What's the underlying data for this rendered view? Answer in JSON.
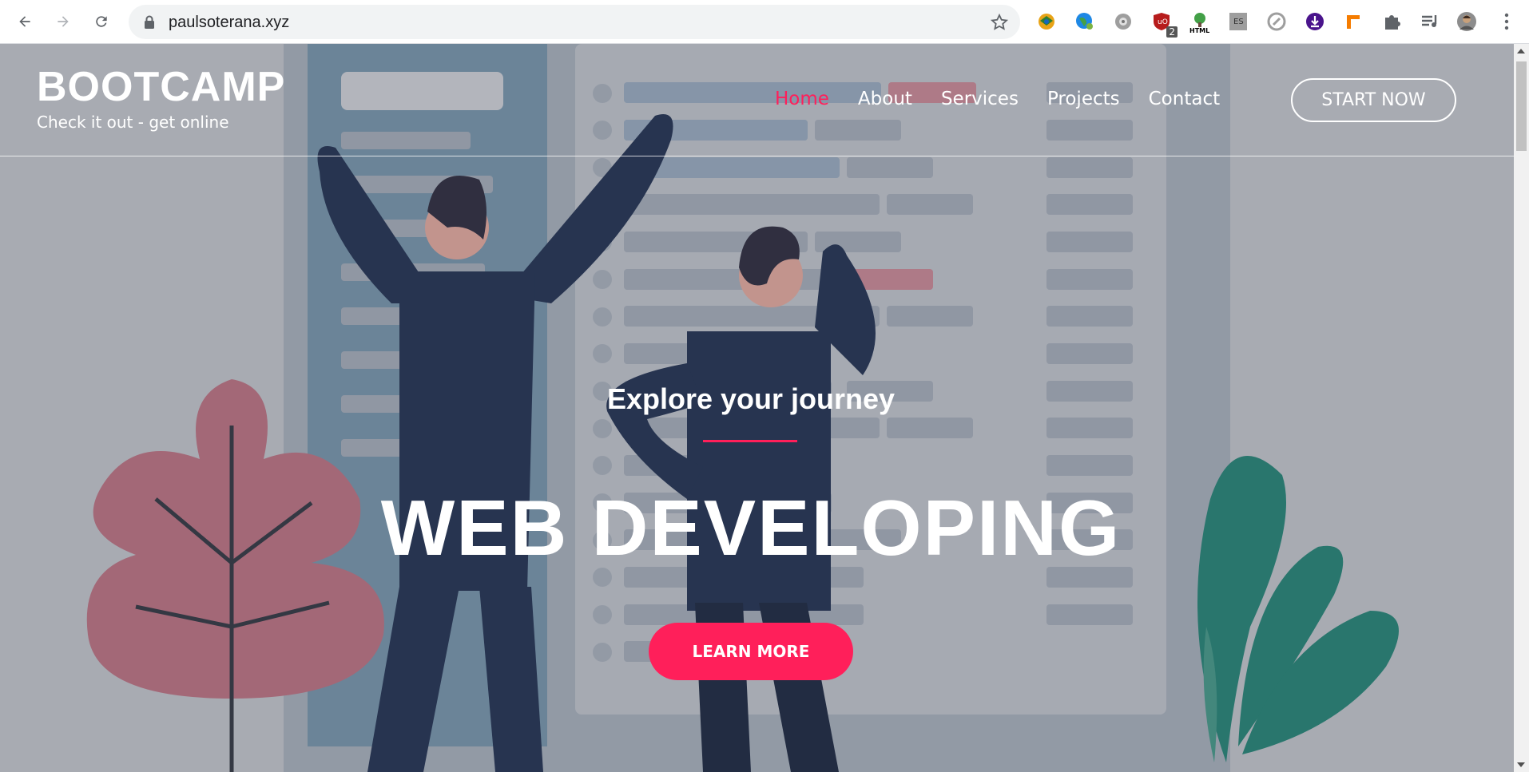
{
  "browser": {
    "url": "paulsoterana.xyz",
    "extensions": [
      {
        "name": "extension-1-icon"
      },
      {
        "name": "globe-extension-icon"
      },
      {
        "name": "gear-extension-icon"
      },
      {
        "name": "ublock-shield-icon",
        "badge": "2"
      },
      {
        "name": "html-tree-icon",
        "label": "HTML"
      },
      {
        "name": "es-extension-icon",
        "label": "ES"
      },
      {
        "name": "link-extension-icon"
      },
      {
        "name": "download-extension-icon"
      },
      {
        "name": "ruler-extension-icon"
      },
      {
        "name": "puzzle-extensions-icon"
      },
      {
        "name": "media-queue-icon"
      },
      {
        "name": "profile-avatar-icon"
      },
      {
        "name": "kebab-menu-icon"
      }
    ]
  },
  "header": {
    "brand_title": "BOOTCAMP",
    "brand_subtitle": "Check it out - get online",
    "menu": [
      {
        "label": "Home",
        "active": true
      },
      {
        "label": "About",
        "active": false
      },
      {
        "label": "Services",
        "active": false
      },
      {
        "label": "Projects",
        "active": false
      },
      {
        "label": "Contact",
        "active": false
      }
    ],
    "cta_label": "START NOW"
  },
  "hero": {
    "tagline": "Explore your journey",
    "headline": "WEB DEVELOPING",
    "button_label": "LEARN MORE"
  },
  "colors": {
    "accent": "#ff1f5a",
    "overlay": "#a9abb3",
    "navy": "#0b1a3b",
    "teal": "#0e6b5e",
    "pink_leaf": "#a3596b"
  }
}
